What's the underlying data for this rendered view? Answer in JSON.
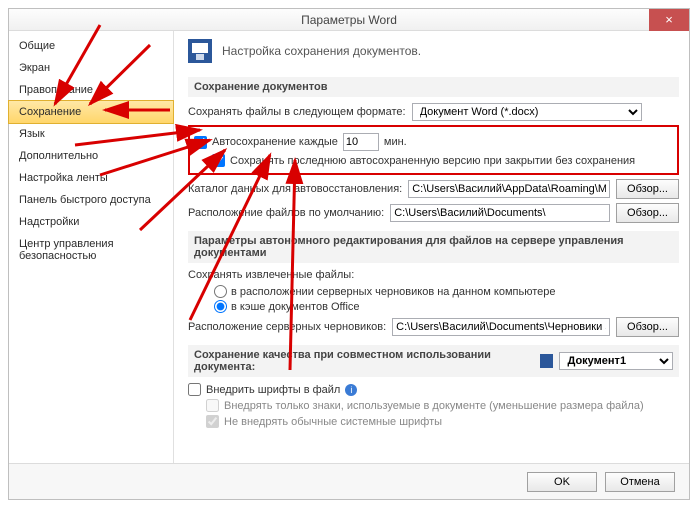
{
  "window": {
    "title": "Параметры Word"
  },
  "sidebar": {
    "items": [
      {
        "label": "Общие"
      },
      {
        "label": "Экран"
      },
      {
        "label": "Правописание"
      },
      {
        "label": "Сохранение",
        "selected": true
      },
      {
        "label": "Язык"
      },
      {
        "label": "Дополнительно"
      },
      {
        "label": "Настройка ленты"
      },
      {
        "label": "Панель быстрого доступа"
      },
      {
        "label": "Надстройки"
      },
      {
        "label": "Центр управления безопасностью"
      }
    ]
  },
  "header": {
    "text": "Настройка сохранения документов."
  },
  "section_save": {
    "title": "Сохранение документов",
    "format_label": "Сохранять файлы в следующем формате:",
    "format_value": "Документ Word (*.docx)",
    "autosave_checkbox": "Автосохранение каждые",
    "autosave_value": "10",
    "autosave_unit": "мин.",
    "keep_last_checkbox": "Сохранять последнюю автосохраненную версию при закрытии без сохранения",
    "recover_dir_label": "Каталог данных для автовосстановления:",
    "recover_dir_value": "C:\\Users\\Василий\\AppData\\Roaming\\Microsoft\\Word\\",
    "default_loc_label": "Расположение файлов по умолчанию:",
    "default_loc_value": "C:\\Users\\Василий\\Documents\\",
    "browse": "Обзор..."
  },
  "section_offline": {
    "title": "Параметры автономного редактирования для файлов на сервере управления документами",
    "save_extracted_label": "Сохранять извлеченные файлы:",
    "radio_server": "в расположении серверных черновиков на данном компьютере",
    "radio_cache": "в кэше документов Office",
    "drafts_loc_label": "Расположение серверных черновиков:",
    "drafts_loc_value": "C:\\Users\\Василий\\Documents\\Черновики SharePoint\\",
    "browse": "Обзор..."
  },
  "section_quality": {
    "title": "Сохранение качества при совместном использовании документа:",
    "doc_value": "Документ1",
    "embed_fonts": "Внедрить шрифты в файл",
    "embed_used_only": "Внедрять только знаки, используемые в документе (уменьшение размера файла)",
    "skip_system_fonts": "Не внедрять обычные системные шрифты"
  },
  "footer": {
    "ok": "OK",
    "cancel": "Отмена"
  }
}
